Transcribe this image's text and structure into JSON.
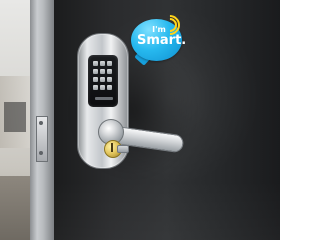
{
  "scene": {
    "background_color": "#2a2b2d",
    "office_color": "#d7d6d2",
    "lock_finish": "#c2c6ca",
    "bubble_color": "#27b9ef",
    "wifi_color": "#ffd31a"
  },
  "badge": {
    "line1": "I'm",
    "line2": "Smart."
  }
}
